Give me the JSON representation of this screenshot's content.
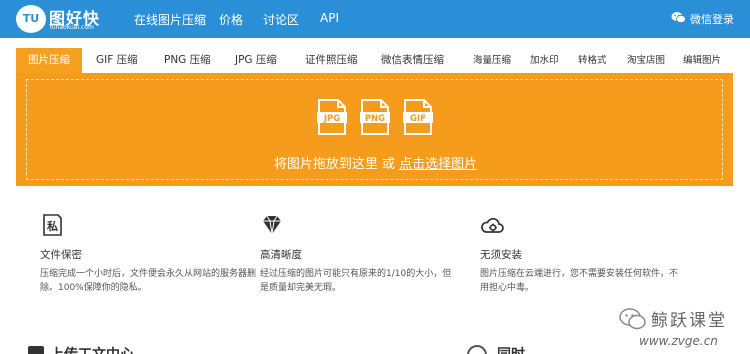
{
  "header": {
    "logo_badge": "TU",
    "logo_name": "图好快",
    "logo_sub": "Tuhaokuai.com",
    "nav": [
      {
        "label": "在线图片压缩"
      },
      {
        "label": "价格"
      },
      {
        "label": "讨论区"
      },
      {
        "label": "API"
      }
    ],
    "login_label": "微信登录"
  },
  "tabs": [
    {
      "label": "图片压缩",
      "active": true
    },
    {
      "label": "GIF 压缩"
    },
    {
      "label": "PNG 压缩"
    },
    {
      "label": "JPG 压缩"
    },
    {
      "label": "证件照压缩"
    },
    {
      "label": "微信表情压缩"
    },
    {
      "label": "海量压缩"
    },
    {
      "label": "加水印"
    },
    {
      "label": "转格式"
    },
    {
      "label": "淘宝店图"
    },
    {
      "label": "编辑图片"
    }
  ],
  "dropzone": {
    "formats": [
      "JPG",
      "PNG",
      "GIF"
    ],
    "text": "将图片拖放到这里 或",
    "link": "点击选择图片"
  },
  "features": [
    {
      "icon": "lock-privacy-icon",
      "icon_char": "私",
      "title": "文件保密",
      "desc": "压缩完成一个小时后，文件便会永久从网站的服务器删除。100%保障你的隐私。"
    },
    {
      "icon": "diamond-icon",
      "title": "高清晰度",
      "desc": "经过压缩的图片可能只有原来的1/10的大小，但是质量却完美无瑕。"
    },
    {
      "icon": "cloud-gear-icon",
      "title": "无须安装",
      "desc": "图片压缩在云端进行，您不需要安装任何软件，不用担心中毒。"
    }
  ],
  "watermark": {
    "title": "鲸跃课堂",
    "url": "www.zvge.cn"
  },
  "bottom_row": {
    "left_text": "上传工文中心",
    "right_text": "同时"
  },
  "colors": {
    "header_bg": "#2b8fd8",
    "accent_orange": "#f59c1c",
    "text": "#333333"
  }
}
